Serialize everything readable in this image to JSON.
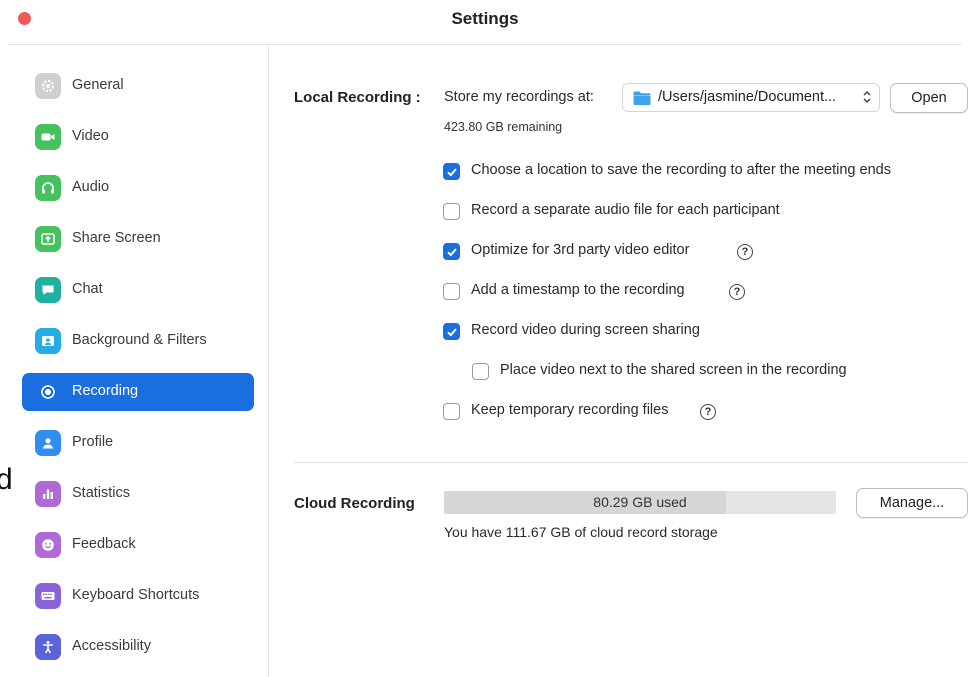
{
  "window": {
    "title": "Settings"
  },
  "sidebar": {
    "items": [
      {
        "label": "General",
        "icon": "gear-icon",
        "color": "#bdbdbd"
      },
      {
        "label": "Video",
        "icon": "video-camera-icon",
        "color": "#3fbf5a"
      },
      {
        "label": "Audio",
        "icon": "headphones-icon",
        "color": "#3fbf5a"
      },
      {
        "label": "Share Screen",
        "icon": "share-screen-icon",
        "color": "#3fbf5a"
      },
      {
        "label": "Chat",
        "icon": "chat-bubble-icon",
        "color": "#1fb0a0"
      },
      {
        "label": "Background & Filters",
        "icon": "background-person-icon",
        "color": "#19aee0"
      },
      {
        "label": "Recording",
        "icon": "record-icon",
        "color": "#1a6fe0"
      },
      {
        "label": "Profile",
        "icon": "profile-icon",
        "color": "#2f8ff0"
      },
      {
        "label": "Statistics",
        "icon": "bar-chart-icon",
        "color": "#a863d8"
      },
      {
        "label": "Feedback",
        "icon": "smiley-icon",
        "color": "#a863d8"
      },
      {
        "label": "Keyboard Shortcuts",
        "icon": "keyboard-icon",
        "color": "#8a63d8"
      },
      {
        "label": "Accessibility",
        "icon": "accessibility-icon",
        "color": "#5a63d8"
      }
    ],
    "active": "Recording",
    "stray_char": "d"
  },
  "local_recording": {
    "label": "Local Recording :",
    "store_label": "Store my recordings at:",
    "path": "/Users/jasmine/Document...",
    "open_button": "Open",
    "remaining": "423.80 GB remaining",
    "options": [
      {
        "label": "Choose a location to save the recording to after the meeting ends",
        "checked": true,
        "help": false
      },
      {
        "label": "Record a separate audio file for each participant",
        "checked": false,
        "help": false
      },
      {
        "label": "Optimize for 3rd party video editor",
        "checked": true,
        "help": true
      },
      {
        "label": "Add a timestamp to the recording",
        "checked": false,
        "help": true
      },
      {
        "label": "Record video during screen sharing",
        "checked": true,
        "help": false
      },
      {
        "label": "Place video next to the shared screen in the recording",
        "checked": false,
        "help": false
      },
      {
        "label": "Keep temporary recording files",
        "checked": false,
        "help": true
      }
    ]
  },
  "cloud_recording": {
    "label": "Cloud Recording",
    "used_text": "80.29 GB used",
    "used_fraction": 0.719,
    "manage_button": "Manage...",
    "storage_text": "You have 111.67 GB of cloud record storage"
  },
  "colors": {
    "accent": "#1a6fe0",
    "close": "#ec5d58"
  }
}
